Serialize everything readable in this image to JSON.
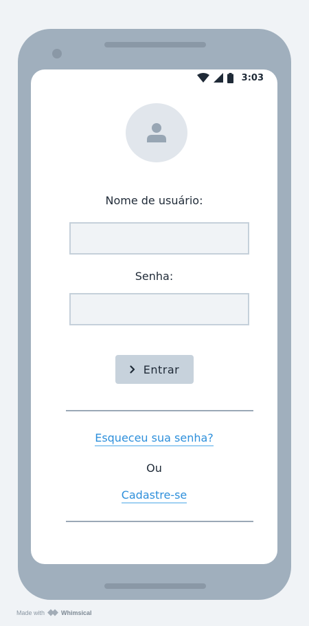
{
  "status_bar": {
    "time": "3:03",
    "icons": [
      "wifi-icon",
      "signal-icon",
      "battery-icon"
    ]
  },
  "avatar": {
    "icon": "user-icon"
  },
  "form": {
    "username_label": "Nome de usuário:",
    "username_value": "",
    "password_label": "Senha:",
    "password_value": "",
    "submit_label": "Entrar",
    "submit_icon": "chevron-right-icon"
  },
  "links": {
    "forgot_password": "Esqueceu sua senha?",
    "or_text": "Ou",
    "register": "Cadastre-se"
  },
  "footer": {
    "made_with": "Made with",
    "brand": "Whimsical"
  },
  "colors": {
    "page_background": "#f0f3f6",
    "device_frame": "#a0afbd",
    "input_border": "#c5d0da",
    "button_background": "#c7d2dc",
    "link": "#2d8fdb"
  }
}
